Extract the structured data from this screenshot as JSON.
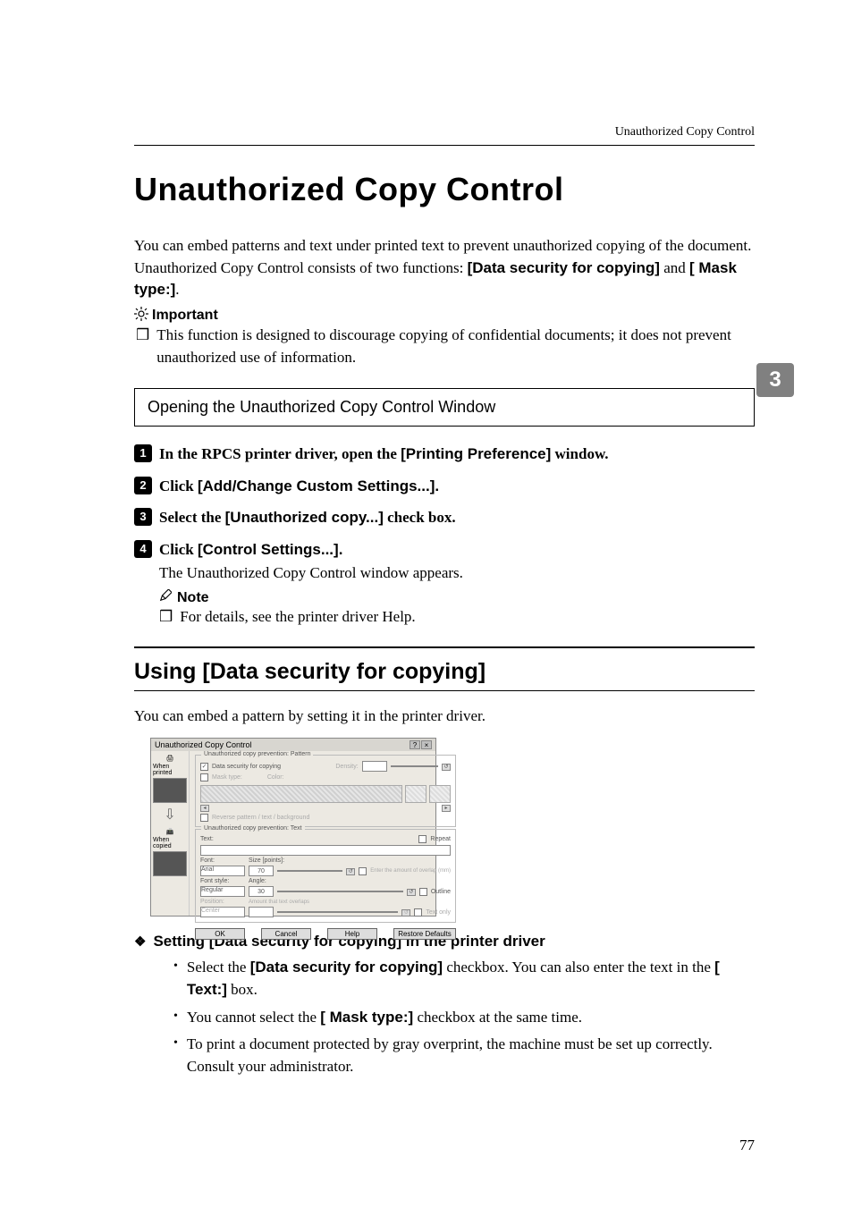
{
  "running_head": "Unauthorized Copy Control",
  "title": "Unauthorized Copy Control",
  "intro": {
    "line1": "You can embed patterns and text under printed text to prevent unauthorized copying of the document. Unauthorized Copy Control consists of two functions:",
    "key1": "[Data security for copying]",
    "join": " and ",
    "key2": "[ Mask type:]",
    "end": "."
  },
  "important": {
    "icon": "❖",
    "label": "Important",
    "bullet_mark": "❒",
    "text": "This function is designed to discourage copying of confidential documents; it does not prevent unauthorized use of information."
  },
  "subsection_box": "Opening the Unauthorized Copy Control Window",
  "steps": [
    {
      "num": "1",
      "serif_a": "In the RPCS printer driver, open the ",
      "sans": "[Printing Preference]",
      "serif_b": " window."
    },
    {
      "num": "2",
      "serif_a": "Click ",
      "sans": "[Add/Change Custom Settings...].",
      "serif_b": ""
    },
    {
      "num": "3",
      "serif_a": "Select the ",
      "sans": "[Unauthorized copy...]",
      "serif_b": " check box."
    },
    {
      "num": "4",
      "serif_a": "Click ",
      "sans": "[Control Settings...].",
      "serif_b": ""
    }
  ],
  "step4_sub": "The Unauthorized Copy Control window appears.",
  "note": {
    "label": "Note",
    "bullet_mark": "❒",
    "text": "For details, see the printer driver Help."
  },
  "h2": "Using [Data security for copying]",
  "h2_body": "You can embed a pattern by setting it in the printer driver.",
  "screenshot": {
    "title": "Unauthorized Copy Control",
    "left_printed": "When printed",
    "left_copied": "When copied",
    "group1_legend": "Unauthorized copy prevention: Pattern",
    "data_sec_label": "Data security for copying",
    "mask_label": "Mask type:",
    "color_label": "Color:",
    "reverse_label": "Reverse pattern / text / background",
    "group2_legend": "Unauthorized copy prevention: Text",
    "text_label": "Text:",
    "repeat_label": "Repeat",
    "font_label": "Font:",
    "font_val": "Arial",
    "size_label": "Size [points]:",
    "size_val": "70",
    "linesp_label": "Enter the amount of overlap (mm)",
    "style_label": "Font style:",
    "style_val": "Regular",
    "angle_label": "Angle:",
    "angle_val": "30",
    "outline_label": "Outline",
    "pos_label": "Position:",
    "pos_val": "Center",
    "overlap_label": "Amount that text overlaps",
    "textonly_label": "Text only",
    "btn_ok": "OK",
    "btn_cancel": "Cancel",
    "btn_help": "Help",
    "btn_restore": "Restore Defaults"
  },
  "diamond_head": "Setting [Data security for copying] in the printer driver",
  "dot_bullets": [
    {
      "pre": "Select the ",
      "b1": "[Data security for copying]",
      "mid": " checkbox. You can also enter the text in the ",
      "b2": "[ Text:]",
      "post": " box."
    },
    {
      "pre": "You cannot select the ",
      "b1": "[ Mask type:]",
      "mid": " checkbox at the same time.",
      "b2": "",
      "post": ""
    },
    {
      "pre": "To print a document protected by gray overprint, the machine must be set up correctly. Consult your administrator.",
      "b1": "",
      "mid": "",
      "b2": "",
      "post": ""
    }
  ],
  "side_tab": "3",
  "page_number": "77"
}
